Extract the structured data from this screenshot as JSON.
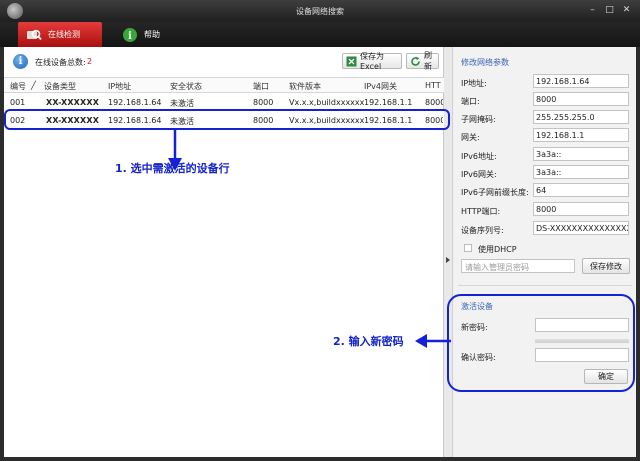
{
  "window": {
    "title": "设备网络搜索"
  },
  "nav": {
    "tabs": [
      {
        "label": "在线检测",
        "icon": "search-device-icon",
        "active": true
      },
      {
        "label": "帮助",
        "icon": "info-icon",
        "active": false
      }
    ]
  },
  "toolbar": {
    "count_label": "在线设备总数:",
    "count_value": "2",
    "excel_label": "保存为Excel",
    "refresh_label": "刷新"
  },
  "table": {
    "columns": [
      "编号",
      "设备类型",
      "IP地址",
      "安全状态",
      "端口",
      "软件版本",
      "IPv4网关",
      "HTT"
    ],
    "rows": [
      {
        "no": "001",
        "type": "XX-XXXXXX",
        "ip": "192.168.1.64",
        "status": "未激活",
        "port": "8000",
        "version": "Vx.x.x,buildxxxxxx",
        "gateway": "192.168.1.1",
        "http": "8000"
      },
      {
        "no": "002",
        "type": "XX-XXXXXX",
        "ip": "192.168.1.64",
        "status": "未激活",
        "port": "8000",
        "version": "Vx.x.x,buildxxxxxx",
        "gateway": "192.168.1.1",
        "http": "8000"
      }
    ]
  },
  "annotations": {
    "step1": "1. 选中需激活的设备行",
    "step2": "2. 输入新密码",
    "color": "#1421d6"
  },
  "modify": {
    "title": "修改网络参数",
    "fields": [
      {
        "label": "IP地址:",
        "value": "192.168.1.64"
      },
      {
        "label": "端口:",
        "value": "8000"
      },
      {
        "label": "子网掩码:",
        "value": "255.255.255.0"
      },
      {
        "label": "网关:",
        "value": "192.168.1.1"
      },
      {
        "label": "IPv6地址:",
        "value": "3a3a::"
      },
      {
        "label": "IPv6网关:",
        "value": "3a3a::"
      },
      {
        "label": "IPv6子网前缀长度:",
        "value": "64"
      },
      {
        "label": "HTTP端口:",
        "value": "8000"
      },
      {
        "label": "设备序列号:",
        "value": "DS-XXXXXXXXXXXXXXXX"
      }
    ],
    "dhcp_label": "使用DHCP",
    "admin_pw_placeholder": "请输入管理员密码",
    "save_label": "保存修改"
  },
  "activate": {
    "title": "激活设备",
    "new_pw_label": "新密码:",
    "confirm_pw_label": "确认密码:",
    "ok_label": "确定"
  },
  "colors": {
    "accent_red": "#c71c1c",
    "title_blue": "#3a63b8",
    "count_red": "#dd1111"
  }
}
